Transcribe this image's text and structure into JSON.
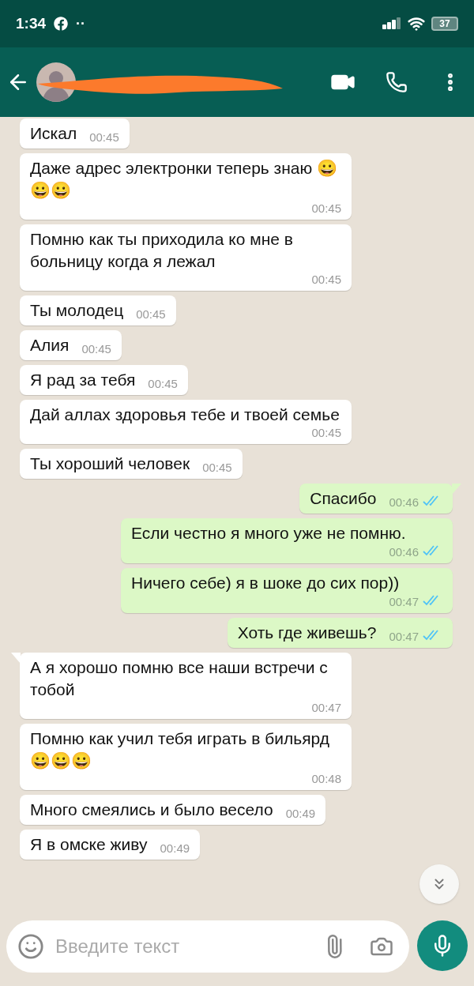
{
  "status_bar": {
    "time": "1:34",
    "dots": "··",
    "battery": "37"
  },
  "input": {
    "placeholder": "Введите текст"
  },
  "messages": [
    {
      "kind": "incoming",
      "text": "Искал",
      "time": "00:45"
    },
    {
      "kind": "incoming",
      "text": "Даже адрес электронки теперь знаю 😀😀😀",
      "time": "00:45"
    },
    {
      "kind": "incoming",
      "text": "Помню как ты приходила ко мне в больницу когда я лежал",
      "time": "00:45"
    },
    {
      "kind": "incoming",
      "text": "Ты молодец",
      "time": "00:45"
    },
    {
      "kind": "incoming",
      "text": "Алия",
      "time": "00:45"
    },
    {
      "kind": "incoming",
      "text": "Я рад за тебя",
      "time": "00:45"
    },
    {
      "kind": "incoming",
      "text": "Дай аллах здоровья тебе и твоей семье",
      "time": "00:45"
    },
    {
      "kind": "incoming",
      "text": "Ты хороший человек",
      "time": "00:45"
    },
    {
      "kind": "outgoing",
      "text": "Спасибо",
      "time": "00:46",
      "read": true
    },
    {
      "kind": "outgoing",
      "text": "Если честно я много уже не помню.",
      "time": "00:46",
      "read": true
    },
    {
      "kind": "outgoing",
      "text": "Ничего себе) я в шоке до сих пор))",
      "time": "00:47",
      "read": true
    },
    {
      "kind": "outgoing",
      "text": "Хоть где живешь?",
      "time": "00:47",
      "read": true
    },
    {
      "kind": "incoming",
      "text": "А я хорошо помню все наши встречи с тобой",
      "time": "00:47"
    },
    {
      "kind": "incoming",
      "text": "Помню как учил тебя играть в бильярд 😀😀😀",
      "time": "00:48"
    },
    {
      "kind": "incoming",
      "text": "Много смеялись и было весело",
      "time": "00:49"
    },
    {
      "kind": "incoming",
      "text": "Я в омске живу",
      "time": "00:49"
    }
  ]
}
